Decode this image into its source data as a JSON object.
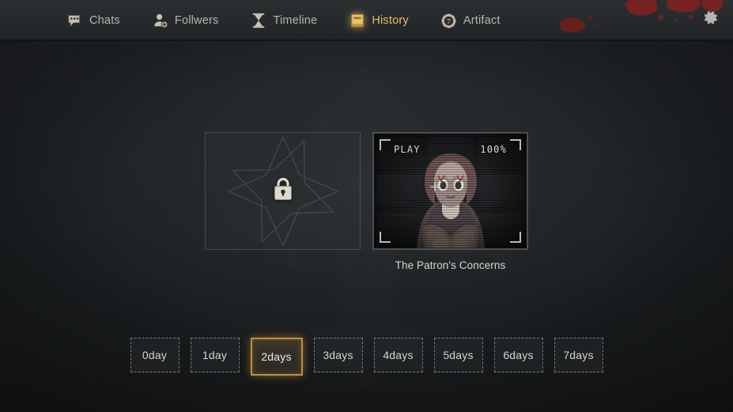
{
  "header": {
    "nav_items": [
      {
        "label": "Chats",
        "icon": "chat-bubble-icon",
        "active": false
      },
      {
        "label": "Follwers",
        "icon": "person-add-icon",
        "active": false
      },
      {
        "label": "Timeline",
        "icon": "hourglass-icon",
        "active": false
      },
      {
        "label": "History",
        "icon": "book-icon",
        "active": true
      },
      {
        "label": "Artifact",
        "icon": "coin-seven-icon",
        "active": false
      }
    ],
    "settings_icon": "gear-icon",
    "active_accent": "#e8bb63"
  },
  "main": {
    "cards": [
      {
        "state": "locked",
        "icon": "padlock-icon",
        "title": ""
      },
      {
        "state": "unlocked",
        "overlay_left": "PLAY",
        "overlay_right": "100%",
        "title": "The Patron's Concerns",
        "thumbnail": "hooded-character-thumbnail"
      }
    ]
  },
  "day_selector": {
    "selected": "2days",
    "options": [
      {
        "label": "0day"
      },
      {
        "label": "1day"
      },
      {
        "label": "2days"
      },
      {
        "label": "3days"
      },
      {
        "label": "4days"
      },
      {
        "label": "5days"
      },
      {
        "label": "6days"
      },
      {
        "label": "7days"
      }
    ]
  },
  "colors": {
    "background": "#1c1e20",
    "header": "#26292c",
    "accent_gold": "#c08f3e",
    "text": "#d6d4cd",
    "blood": "#8a2020"
  }
}
